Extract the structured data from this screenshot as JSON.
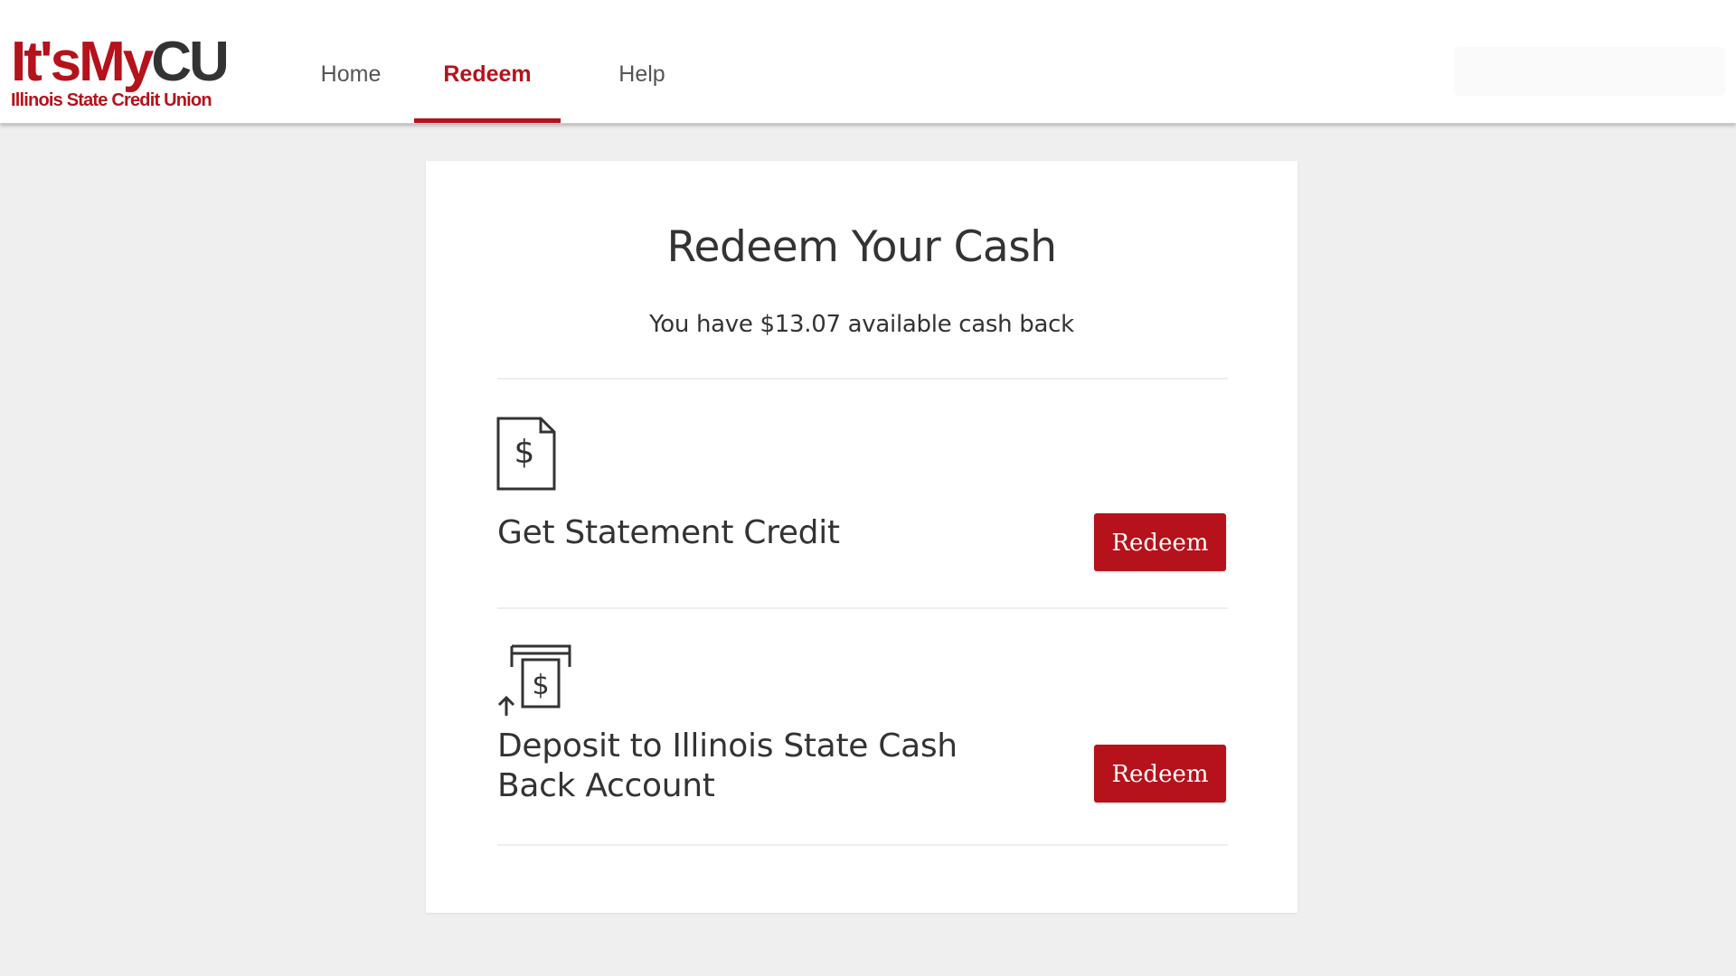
{
  "brand": {
    "logo_its": "It's",
    "logo_my": "My",
    "logo_cu": "CU",
    "tagline": "Illinois State Credit Union"
  },
  "nav": {
    "items": [
      {
        "label": "Home",
        "active": false
      },
      {
        "label": "Redeem",
        "active": true
      },
      {
        "label": "Help",
        "active": false
      }
    ]
  },
  "page": {
    "title": "Redeem Your Cash",
    "available_text": "You have $13.07 available cash back"
  },
  "options": [
    {
      "label": "Get Statement Credit",
      "icon": "document-dollar-icon",
      "button_label": "Redeem"
    },
    {
      "label": "Deposit to Illinois State Cash Back Account",
      "icon": "atm-deposit-icon",
      "button_label": "Redeem"
    }
  ],
  "colors": {
    "accent": "#b5121b",
    "text": "#333333",
    "background": "#efefef"
  }
}
